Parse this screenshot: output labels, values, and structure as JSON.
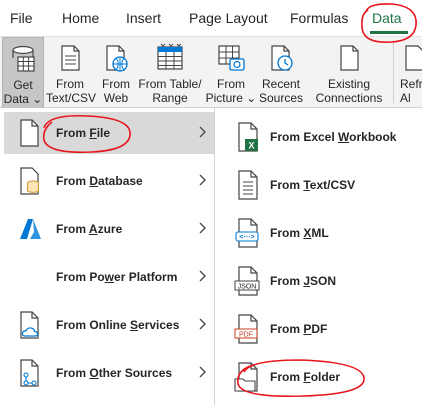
{
  "ribbon_tabs": [
    {
      "label": "File"
    },
    {
      "label": "Home"
    },
    {
      "label": "Insert"
    },
    {
      "label": "Page Layout"
    },
    {
      "label": "Formulas"
    },
    {
      "label": "Data"
    }
  ],
  "ribbon_buttons": {
    "get_data": {
      "line1": "Get",
      "line2": "Data ⌄"
    },
    "from_text_csv": {
      "line1": "From",
      "line2": "Text/CSV"
    },
    "from_web": {
      "line1": "From",
      "line2": "Web"
    },
    "from_table_range": {
      "line1": "From Table/",
      "line2": "Range"
    },
    "from_picture": {
      "line1": "From",
      "line2": "Picture ⌄"
    },
    "recent_sources": {
      "line1": "Recent",
      "line2": "Sources"
    },
    "existing_connections": {
      "line1": "Existing",
      "line2": "Connections"
    },
    "refresh_all": {
      "line1": "Refr",
      "line2": "Al"
    }
  },
  "menu": {
    "items": [
      {
        "pre": "From ",
        "ul": "F",
        "post": "ile",
        "icon": "file-icon"
      },
      {
        "pre": "From ",
        "ul": "D",
        "post": "atabase",
        "icon": "database-icon"
      },
      {
        "pre": "From ",
        "ul": "A",
        "post": "zure",
        "icon": "azure-icon"
      },
      {
        "pre": "From Po",
        "ul": "w",
        "post": "er Platform",
        "icon": ""
      },
      {
        "pre": "From Online ",
        "ul": "S",
        "post": "ervices",
        "icon": "cloud-file-icon"
      },
      {
        "pre": "From ",
        "ul": "O",
        "post": "ther Sources",
        "icon": "other-sources-icon"
      }
    ]
  },
  "submenu": {
    "items": [
      {
        "pre": "From Excel ",
        "ul": "W",
        "post": "orkbook",
        "icon": "excel-workbook-icon",
        "badge": "X"
      },
      {
        "pre": "From ",
        "ul": "T",
        "post": "ext/CSV",
        "icon": "text-file-icon",
        "badge": ""
      },
      {
        "pre": "From ",
        "ul": "X",
        "post": "ML",
        "icon": "xml-file-icon",
        "badge": "<⋯>"
      },
      {
        "pre": "From ",
        "ul": "J",
        "post": "SON",
        "icon": "json-file-icon",
        "badge": "JSON"
      },
      {
        "pre": "From ",
        "ul": "P",
        "post": "DF",
        "icon": "pdf-file-icon",
        "badge": "PDF"
      },
      {
        "pre": "From ",
        "ul": "F",
        "post": "older",
        "icon": "folder-icon",
        "badge": ""
      }
    ]
  },
  "colors": {
    "accent_green": "#217346",
    "annotation_red": "#e8141c",
    "azure_blue": "#0078d4",
    "pdf_red": "#c43e1c",
    "db_orange": "#d59b3b"
  }
}
